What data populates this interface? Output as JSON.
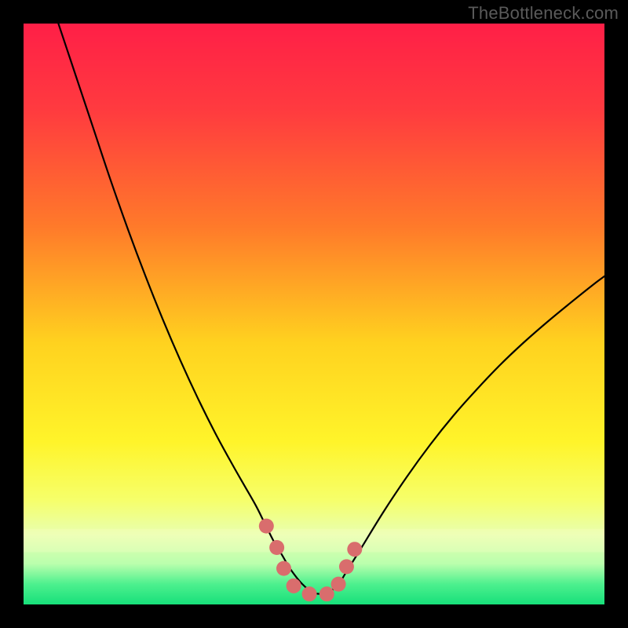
{
  "watermark": "TheBottleneck.com",
  "chart_data": {
    "type": "line",
    "title": "",
    "xlabel": "",
    "ylabel": "",
    "xlim": [
      0,
      100
    ],
    "ylim": [
      0,
      100
    ],
    "gradient_stops": [
      {
        "offset": 0.0,
        "color": "#ff1f47"
      },
      {
        "offset": 0.15,
        "color": "#ff3b3f"
      },
      {
        "offset": 0.35,
        "color": "#ff7a2a"
      },
      {
        "offset": 0.55,
        "color": "#ffd21f"
      },
      {
        "offset": 0.72,
        "color": "#fff42a"
      },
      {
        "offset": 0.82,
        "color": "#f6ff6a"
      },
      {
        "offset": 0.88,
        "color": "#e8ffb0"
      },
      {
        "offset": 0.93,
        "color": "#baffad"
      },
      {
        "offset": 0.965,
        "color": "#4df08e"
      },
      {
        "offset": 1.0,
        "color": "#17e07a"
      }
    ],
    "series": [
      {
        "name": "bottleneck-curve",
        "stroke": "#000000",
        "stroke_width": 2.2,
        "x": [
          6,
          8,
          10,
          12,
          15,
          18,
          21,
          24,
          27,
          30,
          33,
          36,
          38,
          40,
          41.5,
          43,
          44.5,
          46,
          48,
          50,
          52,
          54,
          55.5,
          58,
          62,
          66,
          70,
          74,
          78,
          82,
          86,
          90,
          94,
          98,
          100
        ],
        "y": [
          100,
          94,
          88,
          82,
          73,
          64.5,
          56.5,
          49,
          42,
          35.5,
          29.5,
          24,
          20.5,
          17,
          14,
          11,
          8.5,
          6,
          3.5,
          2,
          2,
          3.2,
          5.5,
          9.5,
          16,
          22,
          27.5,
          32.5,
          37,
          41.2,
          45,
          48.5,
          51.8,
          55,
          56.5
        ]
      },
      {
        "name": "marker-dots",
        "fill": "#d96d6d",
        "radius": 9.5,
        "points": [
          {
            "x": 41.8,
            "y": 13.5
          },
          {
            "x": 43.6,
            "y": 9.8
          },
          {
            "x": 44.8,
            "y": 6.2
          },
          {
            "x": 46.5,
            "y": 3.2
          },
          {
            "x": 49.2,
            "y": 1.8
          },
          {
            "x": 52.2,
            "y": 1.8
          },
          {
            "x": 54.2,
            "y": 3.5
          },
          {
            "x": 55.6,
            "y": 6.5
          },
          {
            "x": 57.0,
            "y": 9.5
          }
        ]
      }
    ]
  }
}
